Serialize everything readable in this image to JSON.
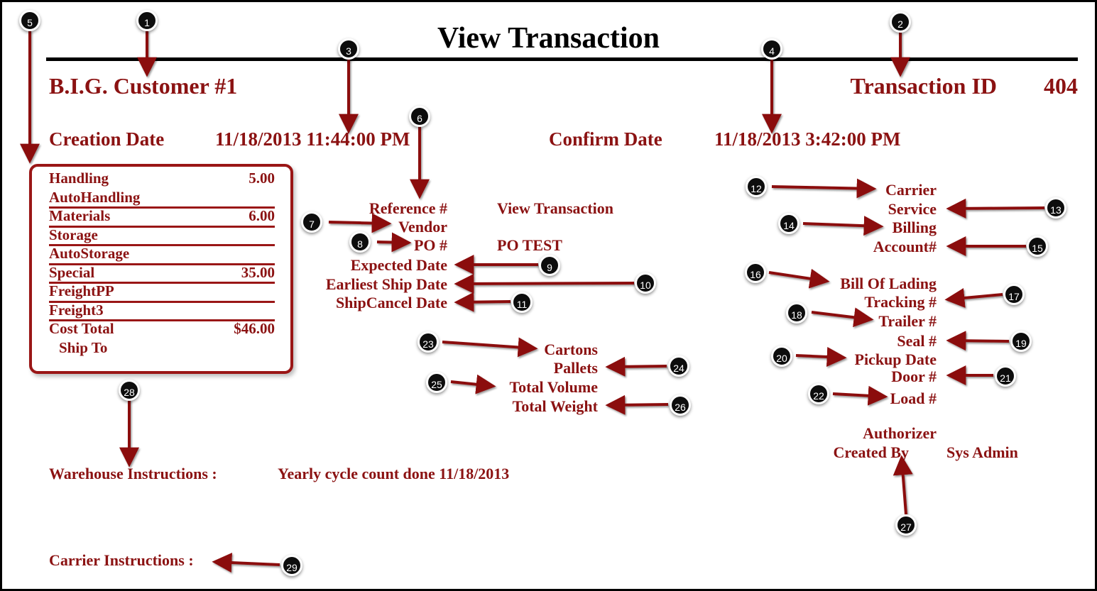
{
  "document": {
    "title": "View Transaction",
    "customer_name": "B.I.G. Customer #1",
    "transaction_id_label": "Transaction ID",
    "transaction_id_value": "404",
    "creation_date_label": "Creation Date",
    "creation_date_value": "11/18/2013 11:44:00 PM",
    "confirm_date_label": "Confirm Date",
    "confirm_date_value": "11/18/2013 3:42:00 PM"
  },
  "cost_box": {
    "rows": [
      {
        "label": "Handling",
        "value": "5.00"
      },
      {
        "label": "AutoHandling",
        "value": ""
      },
      {
        "label": "Materials",
        "value": "6.00"
      },
      {
        "label": "Storage",
        "value": ""
      },
      {
        "label": "AutoStorage",
        "value": ""
      },
      {
        "label": "Special",
        "value": "35.00"
      },
      {
        "label": "FreightPP",
        "value": ""
      },
      {
        "label": "Freight3",
        "value": ""
      },
      {
        "label": "Cost Total",
        "value": "$46.00"
      },
      {
        "label": "Ship To",
        "value": ""
      }
    ]
  },
  "middle_fields": [
    {
      "label": "Reference #",
      "value": "View Transaction"
    },
    {
      "label": "Vendor",
      "value": ""
    },
    {
      "label": "PO #",
      "value": "PO TEST"
    },
    {
      "label": "Expected Date",
      "value": ""
    },
    {
      "label": "Earliest Ship Date",
      "value": ""
    },
    {
      "label": "ShipCancel Date",
      "value": ""
    }
  ],
  "shipment_fields": [
    {
      "label": "Cartons",
      "value": ""
    },
    {
      "label": "Pallets",
      "value": ""
    },
    {
      "label": "Total Volume",
      "value": ""
    },
    {
      "label": "Total Weight",
      "value": ""
    }
  ],
  "carrier_fields": [
    {
      "label": "Carrier",
      "value": ""
    },
    {
      "label": "Service",
      "value": ""
    },
    {
      "label": "Billing",
      "value": ""
    },
    {
      "label": "Account#",
      "value": ""
    }
  ],
  "shipping_fields": [
    {
      "label": "Bill Of Lading",
      "value": ""
    },
    {
      "label": "Tracking #",
      "value": ""
    },
    {
      "label": "Trailer #",
      "value": ""
    },
    {
      "label": "Seal #",
      "value": ""
    },
    {
      "label": "Pickup Date",
      "value": ""
    },
    {
      "label": "Door #",
      "value": ""
    },
    {
      "label": "Load #",
      "value": ""
    }
  ],
  "footer": {
    "authorizer_label": "Authorizer",
    "created_by_label": "Created By",
    "created_by_value": "Sys Admin",
    "warehouse_instructions_label": "Warehouse Instructions :",
    "warehouse_instructions_value": "Yearly cycle count done 11/18/2013",
    "carrier_instructions_label": "Carrier Instructions :"
  },
  "callouts": [
    {
      "id": "1",
      "number": "1"
    },
    {
      "id": "2",
      "number": "2"
    },
    {
      "id": "3",
      "number": "3"
    },
    {
      "id": "4",
      "number": "4"
    },
    {
      "id": "5",
      "number": "5"
    },
    {
      "id": "6",
      "number": "6"
    },
    {
      "id": "7",
      "number": "7"
    },
    {
      "id": "8",
      "number": "8"
    },
    {
      "id": "9",
      "number": "9"
    },
    {
      "id": "10",
      "number": "10"
    },
    {
      "id": "11",
      "number": "11"
    },
    {
      "id": "12",
      "number": "12"
    },
    {
      "id": "13",
      "number": "13"
    },
    {
      "id": "14",
      "number": "14"
    },
    {
      "id": "15",
      "number": "15"
    },
    {
      "id": "16",
      "number": "16"
    },
    {
      "id": "17",
      "number": "17"
    },
    {
      "id": "18",
      "number": "18"
    },
    {
      "id": "19",
      "number": "19"
    },
    {
      "id": "20",
      "number": "20"
    },
    {
      "id": "21",
      "number": "21"
    },
    {
      "id": "22",
      "number": "22"
    },
    {
      "id": "23",
      "number": "23"
    },
    {
      "id": "24",
      "number": "24"
    },
    {
      "id": "25",
      "number": "25"
    },
    {
      "id": "26",
      "number": "26"
    },
    {
      "id": "27",
      "number": "27"
    },
    {
      "id": "28",
      "number": "28"
    },
    {
      "id": "29",
      "number": "29"
    }
  ],
  "colors": {
    "accent_red": "#8b1212",
    "box_border_red": "#9a1616",
    "arrow_red": "#8b1010",
    "marker_fill": "#0d0d0d",
    "rule_black": "#000000"
  }
}
